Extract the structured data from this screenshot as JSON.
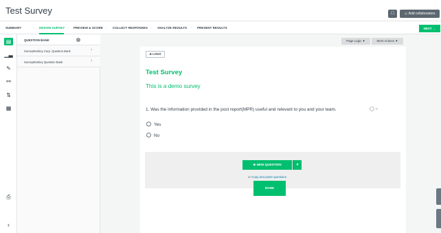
{
  "header": {
    "title": "Test Survey",
    "chat_icon": "chat-bubble-icon",
    "add_collaborators": "Add collaborators"
  },
  "nav": {
    "items": [
      {
        "label": "SUMMARY",
        "active": false
      },
      {
        "label": "DESIGN SURVEY",
        "active": true
      },
      {
        "label": "PREVIEW & SCORE",
        "active": false
      },
      {
        "label": "COLLECT RESPONSES",
        "active": false
      },
      {
        "label": "ANALYZE RESULTS",
        "active": false
      },
      {
        "label": "PRESENT RESULTS",
        "active": false
      }
    ],
    "next_label": "NEXT"
  },
  "sidebar": {
    "icons": [
      "question-bank-icon",
      "bar-chart-icon",
      "pen-icon",
      "logic-branch-icon",
      "sliders-icon",
      "print-grid-icon"
    ],
    "bottom_icons": [
      "print-icon",
      "collapse-chevron-icon"
    ]
  },
  "bank": {
    "header": "QUESTION BANK",
    "help": "?",
    "items": [
      {
        "label": "SurveyMonkey Corp. Question Bank"
      },
      {
        "label": "SurveyMonkey Question Bank"
      }
    ]
  },
  "toolbar": {
    "page_logic": "Page Logic",
    "more_actions": "More Actions"
  },
  "survey": {
    "logo_label": "LOGO",
    "title": "Test Survey",
    "subtitle": "This is a demo survey",
    "question": "1. Was the information provided in the post report(MPR) useful and relevant to you and your team.",
    "question_icons": "comment-icon, logic-icon",
    "options": [
      "Yes",
      "No"
    ]
  },
  "add": {
    "new_question": "NEW QUESTION",
    "or": "or",
    "copy_paste": "Copy and paste questions",
    "done": "DONE"
  },
  "colors": {
    "accent": "#00bf6f",
    "text": "#333e48",
    "link": "#007faa"
  }
}
